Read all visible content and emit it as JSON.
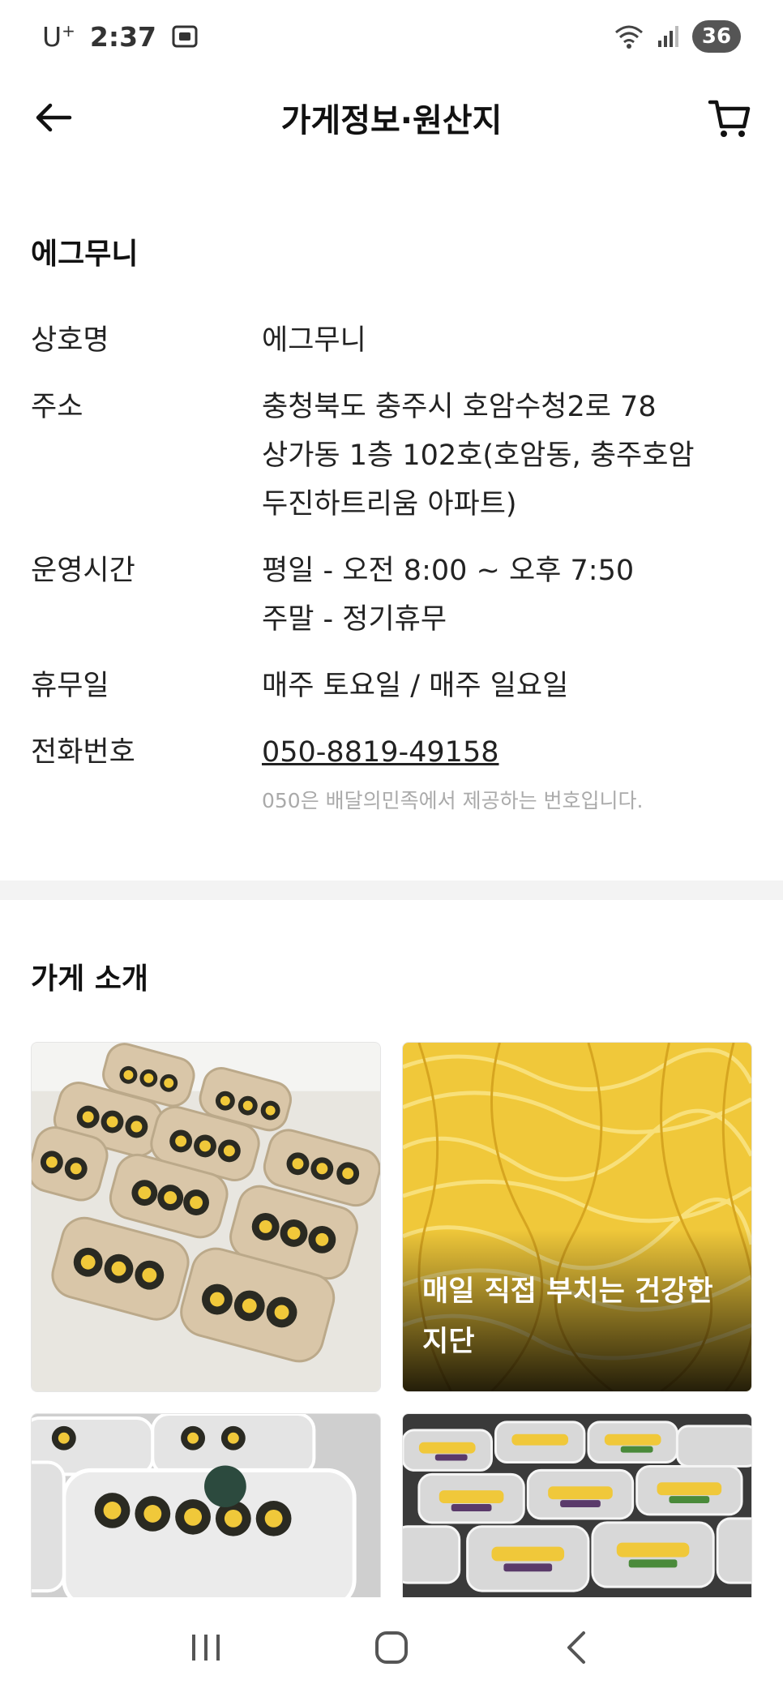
{
  "status_bar": {
    "carrier": "U",
    "carrier_sup": "+",
    "time": "2:37",
    "battery": "36"
  },
  "header": {
    "title": "가게정보·원산지"
  },
  "store": {
    "name": "에그무니",
    "rows": {
      "business_name": {
        "label": "상호명",
        "value": "에그무니"
      },
      "address": {
        "label": "주소",
        "lines": [
          "충청북도 충주시 호암수청2로 78",
          "상가동 1층 102호(호암동, 충주호암",
          "두진하트리움 아파트)"
        ]
      },
      "hours": {
        "label": "운영시간",
        "lines": [
          "평일 - 오전 8:00 ~ 오후 7:50",
          "주말 - 정기휴무"
        ]
      },
      "closed": {
        "label": "휴무일",
        "value": "매주 토요일 / 매주 일요일"
      },
      "phone": {
        "label": "전화번호",
        "value": "050-8819-49158",
        "note": "050은 배달의민족에서 제공하는 번호입니다."
      }
    }
  },
  "intro": {
    "title": "가게 소개",
    "tiles": [
      {
        "caption_lines": []
      },
      {
        "caption_lines": [
          "매일 직접 부치는 건강한",
          "지단"
        ]
      },
      {
        "caption_lines": []
      },
      {
        "caption_lines": []
      }
    ]
  },
  "colors": {
    "egg_yellow": "#f0c83a",
    "kimbap_dark": "#2a2a22",
    "container": "#d9c6a8"
  }
}
